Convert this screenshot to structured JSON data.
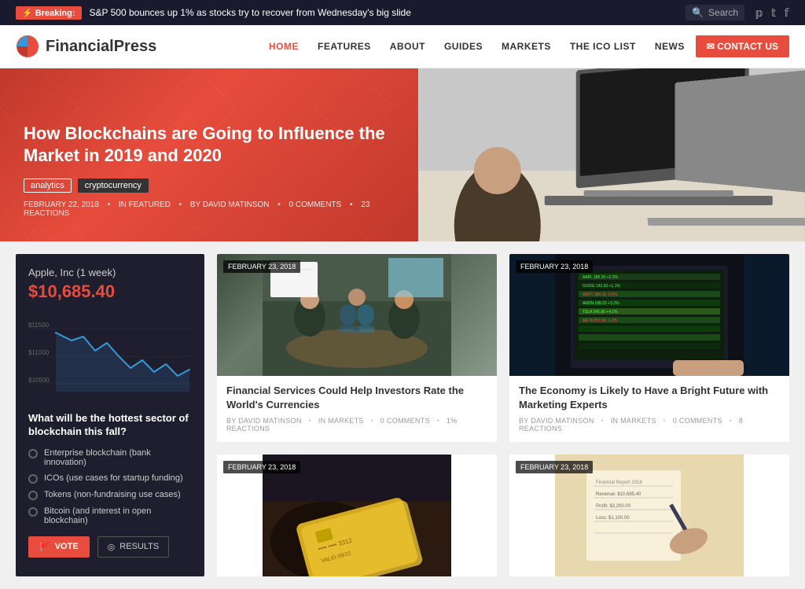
{
  "breaking": {
    "label": "⚡ Breaking:",
    "text": "S&P 500 bounces up 1% as stocks try to recover from Wednesday's big slide",
    "search_placeholder": "Search"
  },
  "header": {
    "logo_text_normal": "Financial",
    "logo_text_bold": "Press",
    "nav": [
      {
        "label": "HOME",
        "active": true
      },
      {
        "label": "FEATURES",
        "active": false
      },
      {
        "label": "ABOUT",
        "active": false
      },
      {
        "label": "GUIDES",
        "active": false
      },
      {
        "label": "MARKETS",
        "active": false
      },
      {
        "label": "THE ICO LIST",
        "active": false
      },
      {
        "label": "NEWS",
        "active": false
      }
    ],
    "contact_label": "✉ CONTACT US"
  },
  "hero": {
    "title": "How Blockchains are Going to Influence the Market in 2019 and 2020",
    "tags": [
      "analytics",
      "cryptocurrency"
    ],
    "date": "FEBRUARY 22, 2018",
    "section": "IN FEATURED",
    "author": "BY DAVID MATINSON",
    "comments": "0 COMMENTS",
    "reactions": "23 REACTIONS"
  },
  "sidebar": {
    "stock_name": "Apple, Inc (1 week)",
    "stock_price": "$10,685.40",
    "chart_labels": [
      "$11500",
      "$11000",
      "$10500"
    ],
    "poll_title": "What will be the hottest sector of blockchain this fall?",
    "poll_options": [
      "Enterprise blockchain (bank innovation)",
      "ICOs (use cases for startup funding)",
      "Tokens (non-fundraising use cases)",
      "Bitcoin (and interest in open blockchain)"
    ],
    "vote_label": "VOTE",
    "results_label": "RESULTS"
  },
  "articles": [
    {
      "date": "FEBRUARY 23, 2018",
      "title": "Financial Services Could Help Investors Rate the World's Currencies",
      "author": "BY DAVID MATINSON",
      "section": "IN MARKETS",
      "comments": "0 COMMENTS",
      "reactions": "1% REACTIONS",
      "img_type": "meeting"
    },
    {
      "date": "FEBRUARY 23, 2018",
      "title": "The Economy is Likely to Have a Bright Future with Marketing Experts",
      "author": "BY DAVID MATINSON",
      "section": "IN MARKETS",
      "comments": "0 COMMENTS",
      "reactions": "8 REACTIONS",
      "img_type": "trading"
    },
    {
      "date": "FEBRUARY 23, 2018",
      "title": "",
      "author": "",
      "section": "",
      "comments": "",
      "reactions": "",
      "img_type": "credit"
    },
    {
      "date": "FEBRUARY 23, 2018",
      "title": "",
      "author": "",
      "section": "",
      "comments": "",
      "reactions": "",
      "img_type": "finance"
    }
  ]
}
